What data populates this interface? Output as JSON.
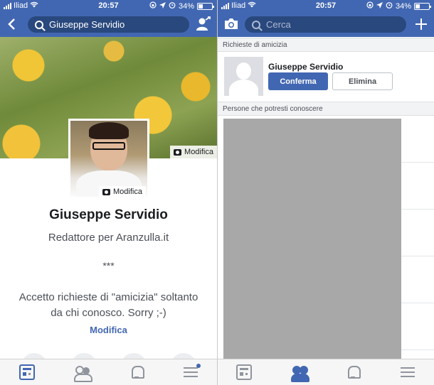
{
  "status_left": {
    "carrier": "Iliad",
    "time": "20:57",
    "battery": "34%"
  },
  "status_right": {
    "carrier": "Iliad",
    "time": "20:57",
    "battery": "34%"
  },
  "profile": {
    "search_value": "Giuseppe Servidio",
    "cover_edit_label": "Modifica",
    "photo_edit_label": "Modifica",
    "name": "Giuseppe Servidio",
    "bio": "Redattore per Aranzulla.it",
    "separator": "***",
    "intro_line1": "Accetto richieste di \"amicizia\" soltanto",
    "intro_line2": "da chi conosco. Sorry ;-)",
    "edit_link": "Modifica"
  },
  "friends": {
    "search_placeholder": "Cerca",
    "requests_header": "Richieste di amicizia",
    "request_name": "Giuseppe Servidio",
    "confirm_label": "Conferma",
    "delete_label": "Elimina",
    "suggestions_header": "Persone che potresti conoscere"
  },
  "icons": {
    "back": "chevron-left-icon",
    "add_friend": "add-friend-icon",
    "camera": "camera-icon",
    "plus": "plus-icon",
    "feed": "news-feed-icon",
    "friends": "friends-icon",
    "notifications": "bell-icon",
    "menu": "menu-icon"
  },
  "colors": {
    "brand": "#4267b2",
    "brand_dark": "#29487d",
    "gray_block": "#a8a8a8"
  }
}
